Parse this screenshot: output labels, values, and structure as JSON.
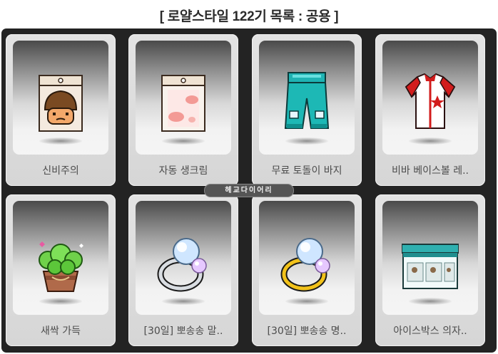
{
  "header": {
    "title": "[ 로얄스타일 122기 목록 : 공용 ]"
  },
  "watermark": "헤교다이어리",
  "items": [
    {
      "name": "신비주의",
      "icon": "mystery-face-package-icon"
    },
    {
      "name": "자동 생크림",
      "icon": "cream-package-icon"
    },
    {
      "name": "무료 토돌이 바지",
      "icon": "blue-pants-icon"
    },
    {
      "name": "비바 베이스볼 레..",
      "icon": "baseball-jersey-icon"
    },
    {
      "name": "새싹 가득",
      "icon": "sprout-pot-icon"
    },
    {
      "name": "[30일] 뽀송송 말..",
      "icon": "silver-pearl-ring-icon"
    },
    {
      "name": "[30일] 뽀송송 명..",
      "icon": "gold-pearl-ring-icon"
    },
    {
      "name": "아이스박스 의자..",
      "icon": "icebox-chair-icon"
    }
  ]
}
